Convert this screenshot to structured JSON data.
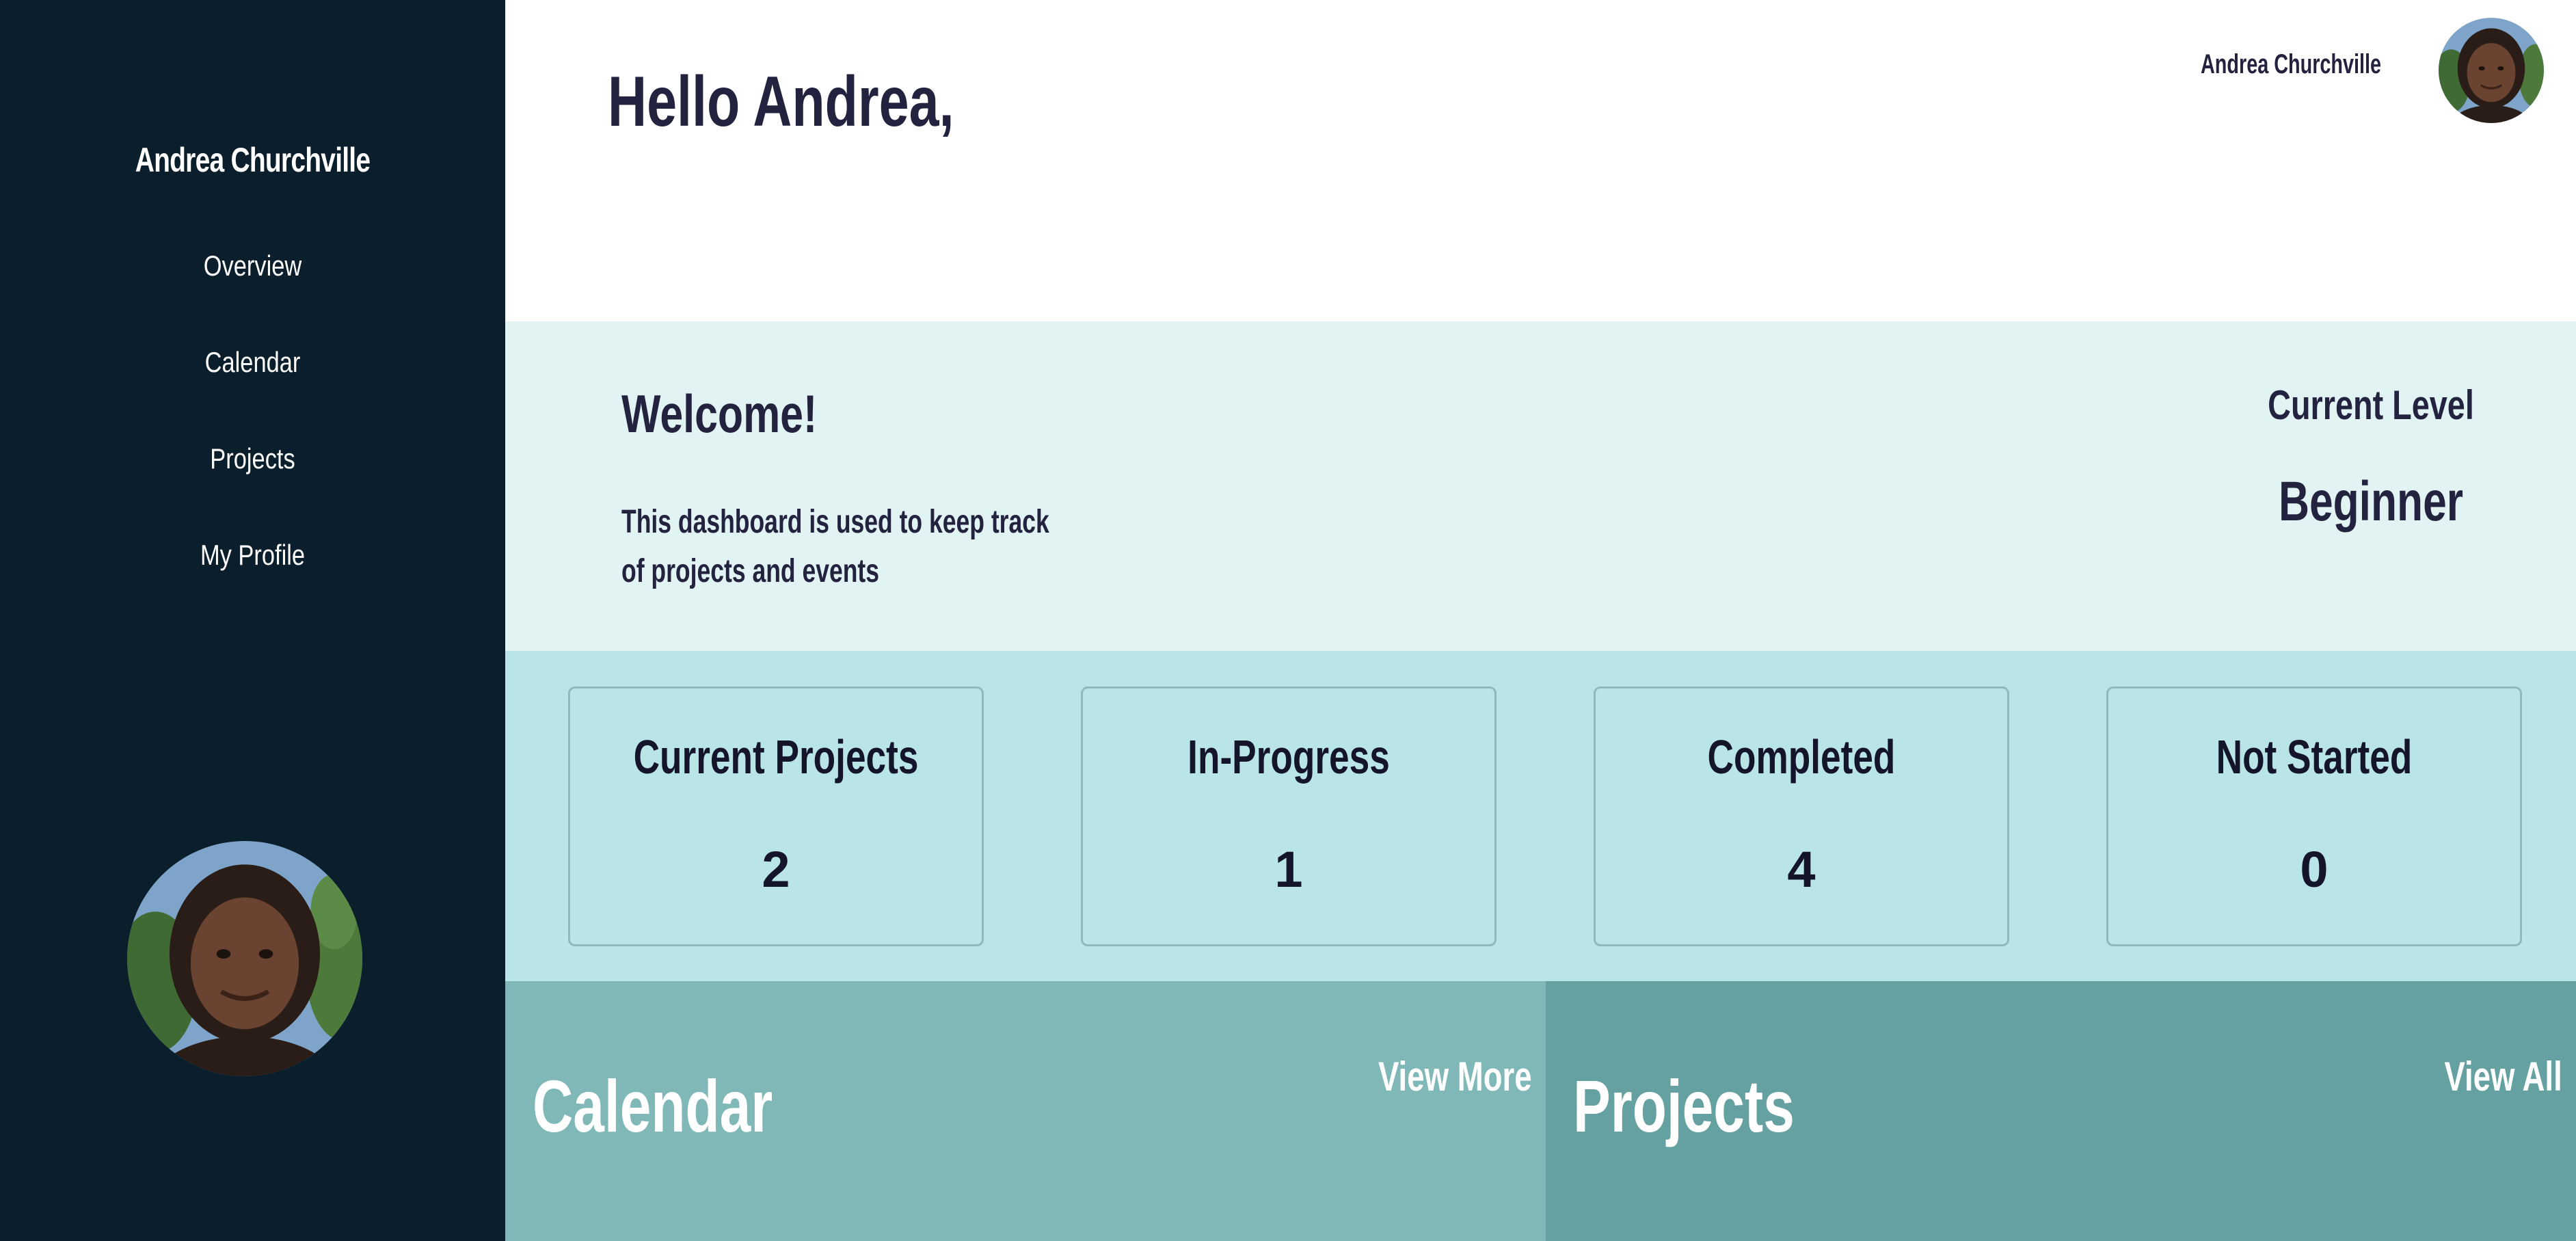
{
  "sidebar": {
    "user_name": "Andrea Churchville",
    "items": [
      {
        "label": "Overview"
      },
      {
        "label": "Calendar"
      },
      {
        "label": "Projects"
      },
      {
        "label": "My Profile"
      }
    ]
  },
  "header": {
    "greeting": "Hello Andrea,",
    "user_name": "Andrea Churchville"
  },
  "welcome": {
    "title": "Welcome!",
    "description": "This dashboard is used to keep track of projects and events",
    "level_label": "Current Level",
    "level_value": "Beginner"
  },
  "stats": [
    {
      "label": "Current Projects",
      "value": "2"
    },
    {
      "label": "In-Progress",
      "value": "1"
    },
    {
      "label": "Completed",
      "value": "4"
    },
    {
      "label": "Not Started",
      "value": "0"
    }
  ],
  "panels": {
    "calendar": {
      "title": "Calendar",
      "link": "View More"
    },
    "projects": {
      "title": "Projects",
      "link": "View All"
    }
  },
  "colors": {
    "sidebar_bg": "#0a1e2b",
    "text_dark": "#23233f",
    "welcome_bg": "#e2f3f4",
    "stats_bg": "#b9e5e6",
    "calendar_bg": "#80b8b8",
    "projects_bg": "#65a1a1"
  }
}
